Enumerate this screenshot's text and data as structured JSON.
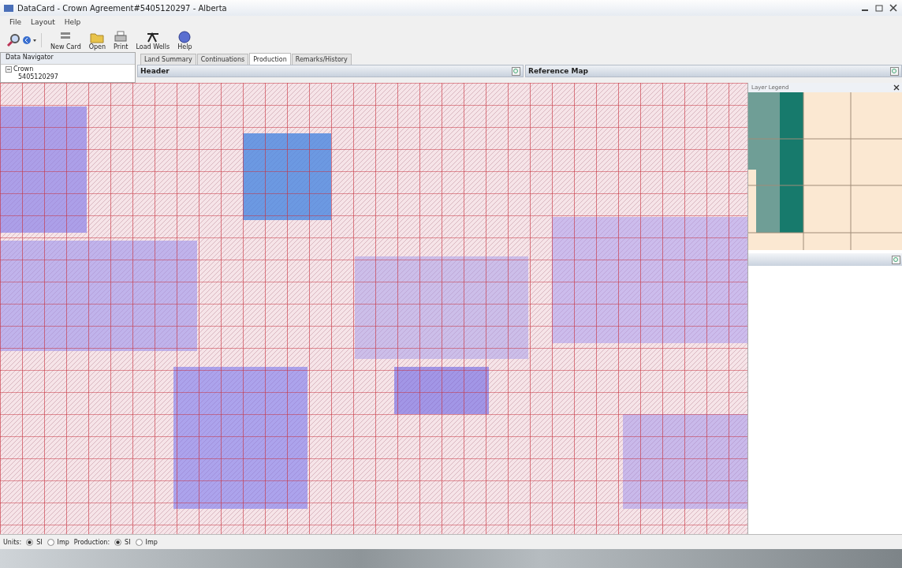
{
  "window": {
    "title": "DataCard - Crown Agreement#5405120297 - Alberta"
  },
  "menu": [
    "File",
    "Layout",
    "Help"
  ],
  "toolbar": [
    {
      "label": "New Card",
      "kind": "card"
    },
    {
      "label": "Open",
      "kind": "open"
    },
    {
      "label": "Print",
      "kind": "print"
    },
    {
      "label": "Load Wells",
      "kind": "wells"
    },
    {
      "label": "Help",
      "kind": "help"
    }
  ],
  "navigator": {
    "title": "Data Navigator",
    "tree": [
      {
        "label": "Crown",
        "expanded": true,
        "children": [
          {
            "label": "5405120297"
          }
        ]
      }
    ]
  },
  "tabs": [
    {
      "label": "Land Summary",
      "selected": false
    },
    {
      "label": "Continuations",
      "selected": false
    },
    {
      "label": "Production",
      "selected": true
    },
    {
      "label": "Remarks/History",
      "selected": false
    }
  ],
  "header_panel": {
    "title": "Header"
  },
  "reference_map": {
    "title": "Reference Map"
  },
  "map": {
    "kind": "picture"
  },
  "layer_legend": {
    "title": "Layer Legend",
    "kind": "picture"
  },
  "status_bar": [
    {
      "label": "Units:",
      "options": [
        {
          "label": "SI",
          "selected": true
        },
        {
          "label": "Imp",
          "selected": false
        }
      ]
    },
    {
      "label": "Production:",
      "options": [
        {
          "label": "SI",
          "selected": true
        },
        {
          "label": "Imp",
          "selected": false
        }
      ]
    }
  ]
}
